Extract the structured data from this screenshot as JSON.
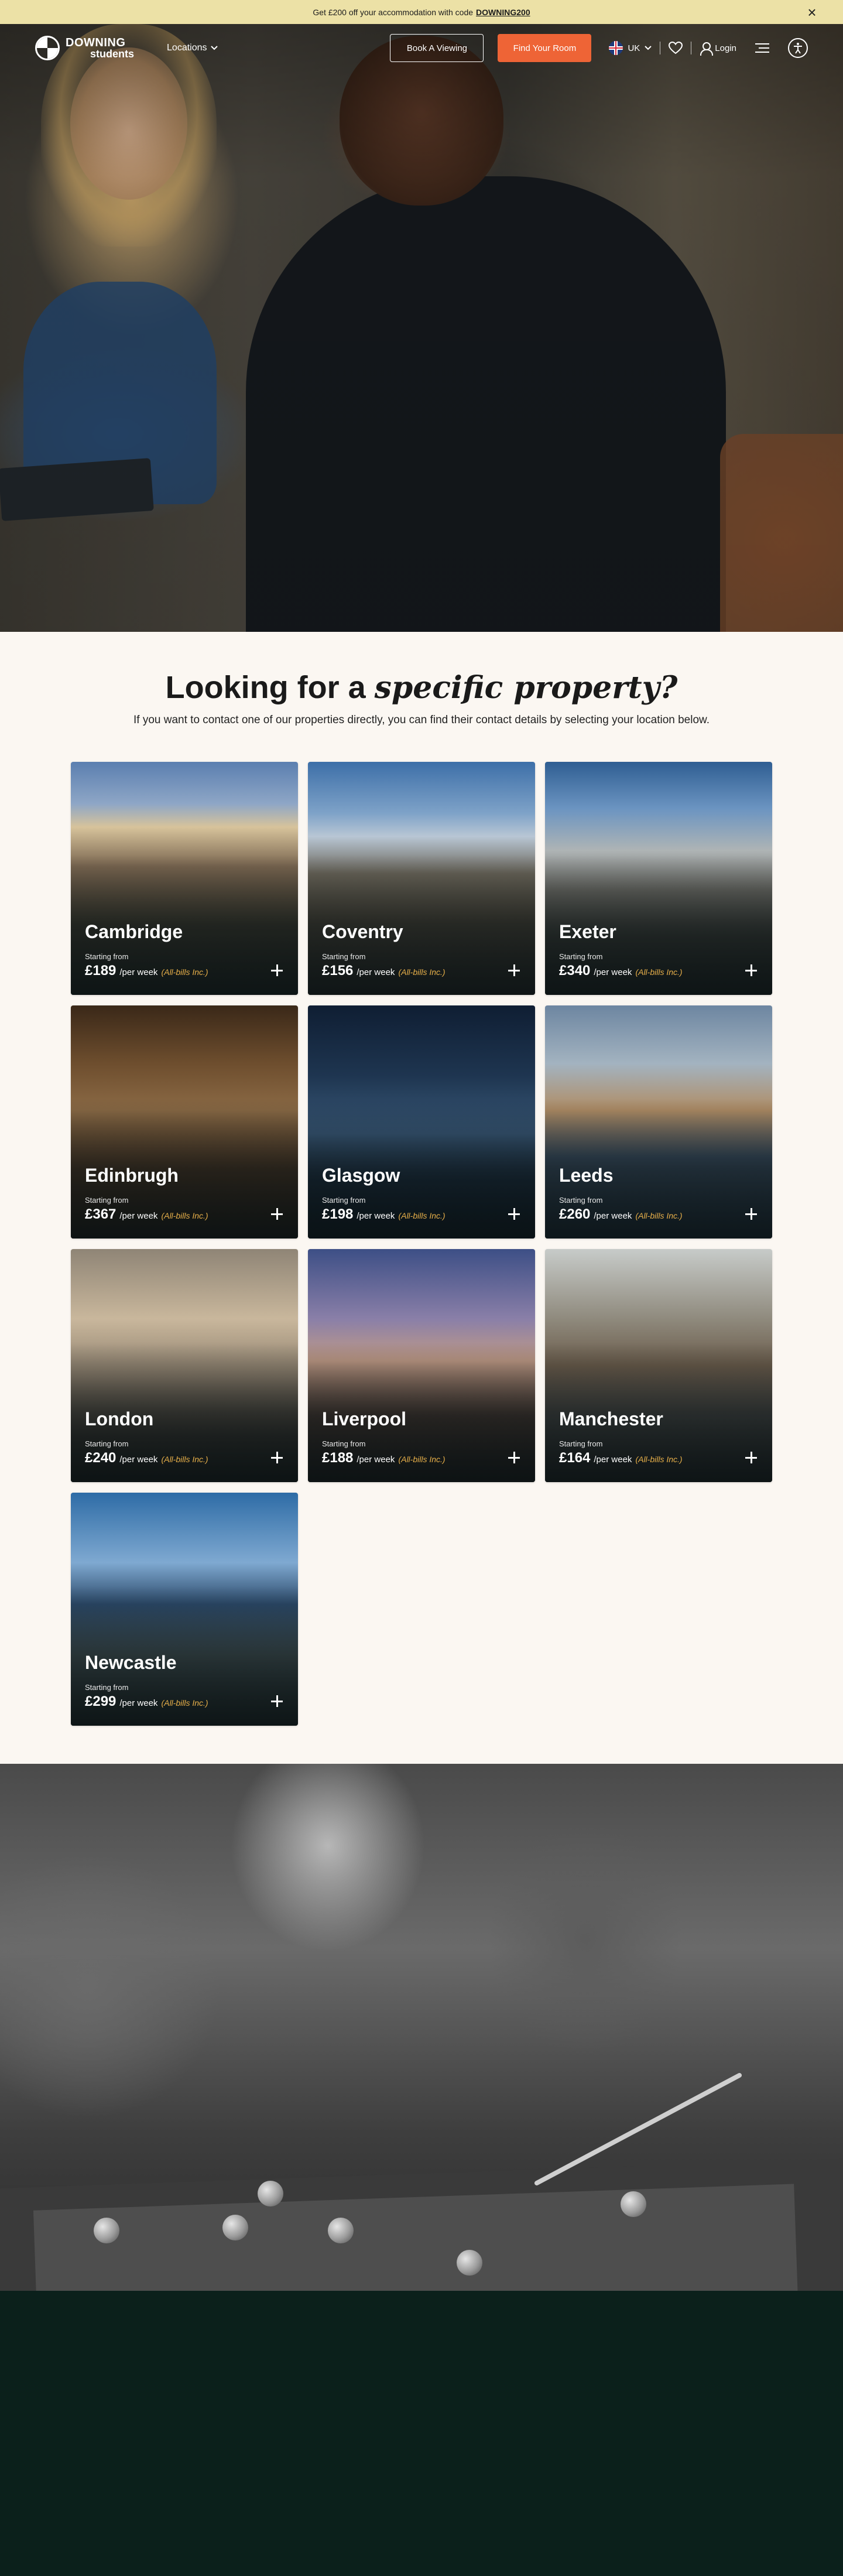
{
  "promo": {
    "text": "Get £200 off your accommodation with code",
    "code": "DOWNING200"
  },
  "nav": {
    "logo_line1": "DOWNING",
    "logo_line2": "students",
    "locations": "Locations",
    "book_viewing": "Book A Viewing",
    "find_room": "Find Your Room",
    "language": "UK",
    "login": "Login"
  },
  "section": {
    "heading_plain": "Looking for a",
    "heading_italic": "specific property?",
    "subheading": "If you want to contact one of our properties directly, you can find their contact details by selecting your location below."
  },
  "cards": [
    {
      "city": "Cambridge",
      "starting": "Starting from",
      "price": "£189",
      "per": "/per week",
      "bills": "(All-bills Inc.)"
    },
    {
      "city": "Coventry",
      "starting": "Starting from",
      "price": "£156",
      "per": "/per week",
      "bills": "(All-bills Inc.)"
    },
    {
      "city": "Exeter",
      "starting": "Starting from",
      "price": "£340",
      "per": "/per week",
      "bills": "(All-bills Inc.)"
    },
    {
      "city": "Edinbrugh",
      "starting": "Starting from",
      "price": "£367",
      "per": "/per week",
      "bills": "(All-bills Inc.)"
    },
    {
      "city": "Glasgow",
      "starting": "Starting from",
      "price": "£198",
      "per": "/per week",
      "bills": "(All-bills Inc.)"
    },
    {
      "city": "Leeds",
      "starting": "Starting from",
      "price": "£260",
      "per": "/per week",
      "bills": "(All-bills Inc.)"
    },
    {
      "city": "London",
      "starting": "Starting from",
      "price": "£240",
      "per": "/per week",
      "bills": "(All-bills Inc.)"
    },
    {
      "city": "Liverpool",
      "starting": "Starting from",
      "price": "£188",
      "per": "/per week",
      "bills": "(All-bills Inc.)"
    },
    {
      "city": "Manchester",
      "starting": "Starting from",
      "price": "£164",
      "per": "/per week",
      "bills": "(All-bills Inc.)"
    },
    {
      "city": "Newcastle",
      "starting": "Starting from",
      "price": "£299",
      "per": "/per week",
      "bills": "(All-bills Inc.)"
    }
  ],
  "colors": {
    "promo_bg": "#ece1a6",
    "accent_button": "#ee6436",
    "bills_text": "#e8b04a",
    "page_bg": "#fbf7f2",
    "footer_bg": "#0b201b"
  },
  "icons": {
    "close": "close-icon",
    "chevron": "chevron-down-icon",
    "flag": "uk-flag-icon",
    "heart": "heart-icon",
    "user": "user-icon",
    "menu": "menu-icon",
    "accessibility": "accessibility-icon",
    "plus": "plus-icon"
  }
}
